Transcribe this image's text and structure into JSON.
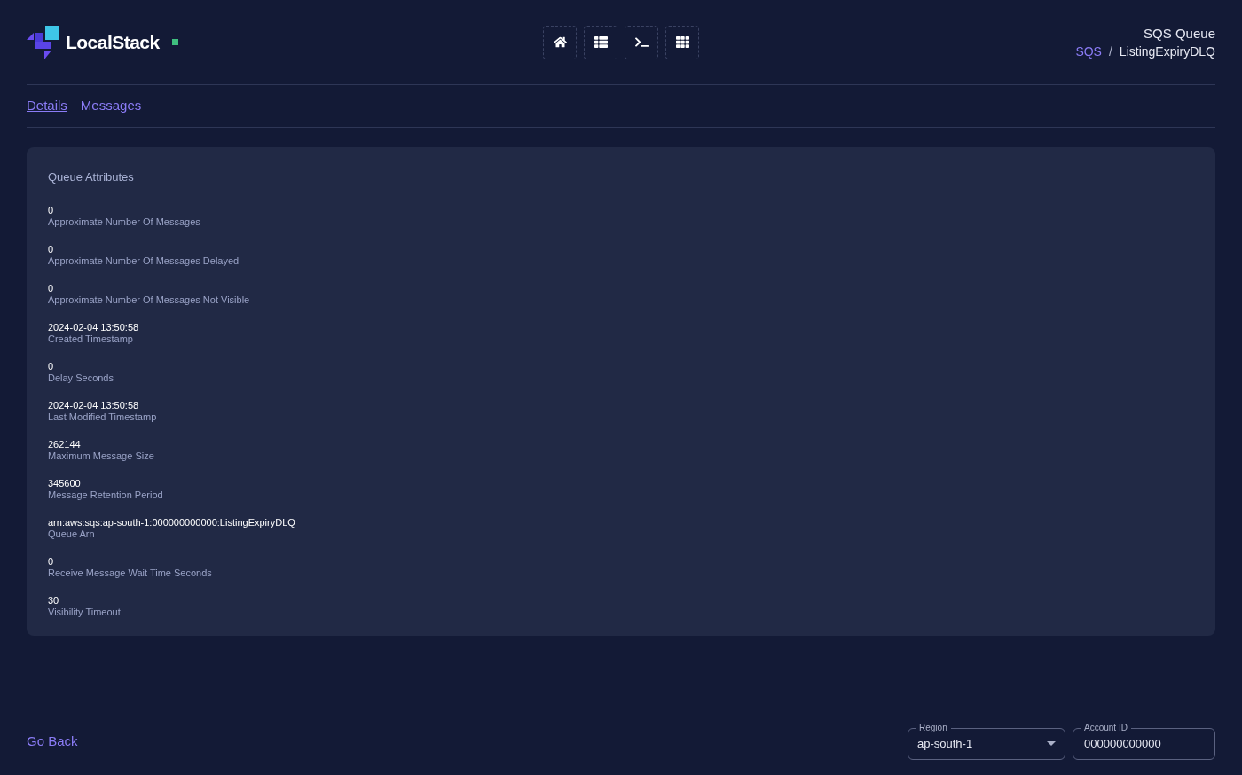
{
  "brand": {
    "name": "LocalStack"
  },
  "toolbar": [
    {
      "kind": "home"
    },
    {
      "kind": "list"
    },
    {
      "kind": "terminal"
    },
    {
      "kind": "grid"
    }
  ],
  "header": {
    "title": "SQS Queue",
    "separator": "/",
    "breadcrumb": [
      {
        "label": "SQS",
        "link": true
      },
      {
        "label": "ListingExpiryDLQ",
        "link": false
      }
    ]
  },
  "tabs": [
    {
      "label": "Details",
      "selected": true
    },
    {
      "label": "Messages",
      "selected": false
    }
  ],
  "card": {
    "title": "Queue Attributes",
    "attributes": [
      {
        "value": "0",
        "label": "Approximate Number Of Messages"
      },
      {
        "value": "0",
        "label": "Approximate Number Of Messages Delayed"
      },
      {
        "value": "0",
        "label": "Approximate Number Of Messages Not Visible"
      },
      {
        "value": "2024-02-04 13:50:58",
        "label": "Created Timestamp"
      },
      {
        "value": "0",
        "label": "Delay Seconds"
      },
      {
        "value": "2024-02-04 13:50:58",
        "label": "Last Modified Timestamp"
      },
      {
        "value": "262144",
        "label": "Maximum Message Size"
      },
      {
        "value": "345600",
        "label": "Message Retention Period"
      },
      {
        "value": "arn:aws:sqs:ap-south-1:000000000000:ListingExpiryDLQ",
        "label": "Queue Arn"
      },
      {
        "value": "0",
        "label": "Receive Message Wait Time Seconds"
      },
      {
        "value": "30",
        "label": "Visibility Timeout"
      }
    ]
  },
  "footer": {
    "back": "Go Back",
    "region": {
      "label": "Region",
      "value": "ap-south-1"
    },
    "account": {
      "label": "Account ID",
      "value": "000000000000"
    }
  }
}
